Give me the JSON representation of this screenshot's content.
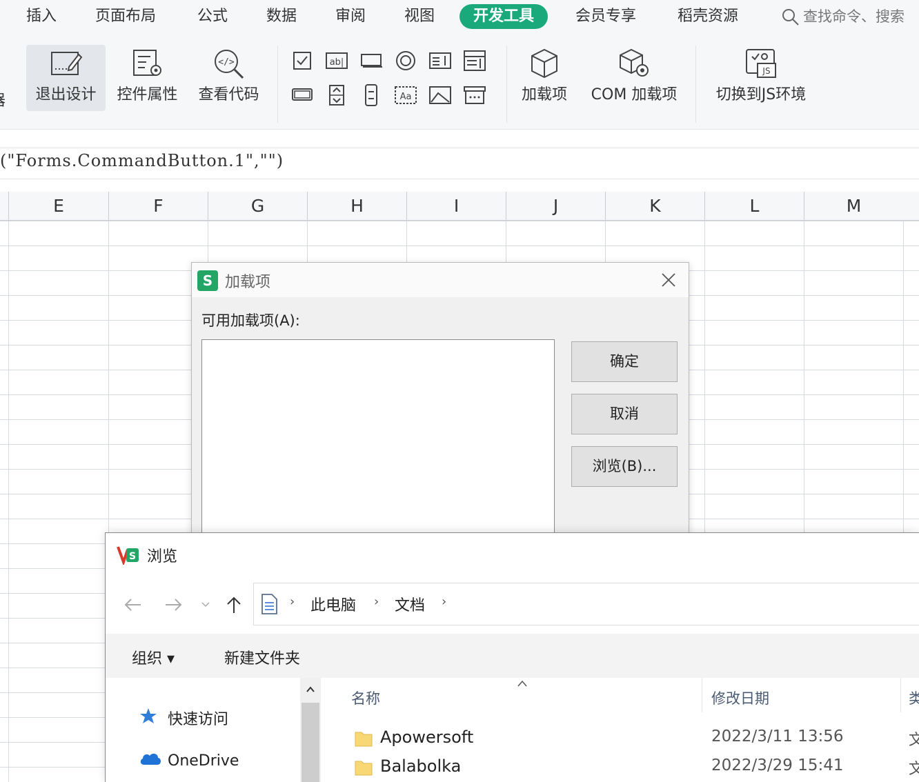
{
  "menu": {
    "items": [
      "插入",
      "页面布局",
      "公式",
      "数据",
      "审阅",
      "视图",
      "开发工具",
      "会员专享",
      "稻壳资源"
    ],
    "active_index": 6,
    "search_text": "查找命令、搜索",
    "accent_color": "#1aa97b"
  },
  "ribbon": {
    "left_cut_label": "器",
    "design_exit": "退出设计",
    "control_props": "控件属性",
    "view_code": "查看代码",
    "addins": "加载项",
    "com_addins": "COM 加载项",
    "switch_js": "切换到JS环境",
    "small_controls": [
      "checkbox-icon",
      "textbox-icon",
      "command-button-icon",
      "option-button-icon",
      "listbox-icon",
      "combo-list-icon",
      "toggle-button-icon",
      "spin-button-icon",
      "scrollbar-icon",
      "label-icon",
      "image-icon",
      "more-controls-icon"
    ]
  },
  "formula": {
    "text": "(\"Forms.CommandButton.1\",\"\")"
  },
  "grid": {
    "columns": [
      "E",
      "F",
      "G",
      "H",
      "I",
      "J",
      "K",
      "L",
      "M"
    ]
  },
  "addin_dialog": {
    "title": "加载项",
    "logo_letter": "S",
    "available_label": "可用加载项(A):",
    "ok": "确定",
    "cancel": "取消",
    "browse": "浏览(B)..."
  },
  "browse_dialog": {
    "title": "浏览",
    "breadcrumbs": [
      "此电脑",
      "文档"
    ],
    "toolbar": {
      "organize": "组织 ▾",
      "new_folder": "新建文件夹"
    },
    "nav": {
      "quick_access": "快速访问",
      "onedrive": "OneDrive"
    },
    "columns": {
      "name": "名称",
      "modified": "修改日期",
      "type": "类"
    },
    "files": [
      {
        "name": "Apowersoft",
        "modified": "2022/3/11 13:56",
        "type": "文"
      },
      {
        "name": "Balabolka",
        "modified": "2022/3/29 15:41",
        "type": "文"
      }
    ]
  }
}
